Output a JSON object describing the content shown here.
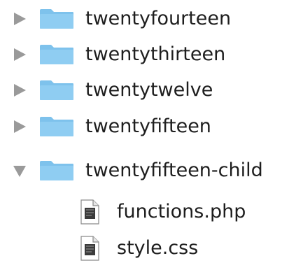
{
  "tree": {
    "items": [
      {
        "name": "twentyfourteen",
        "kind": "folder",
        "expanded": false
      },
      {
        "name": "twentythirteen",
        "kind": "folder",
        "expanded": false
      },
      {
        "name": "twentytwelve",
        "kind": "folder",
        "expanded": false
      },
      {
        "name": "twentyfifteen",
        "kind": "folder",
        "expanded": false
      },
      {
        "name": "twentyfifteen-child",
        "kind": "folder",
        "expanded": true
      },
      {
        "name": "functions.php",
        "kind": "file"
      },
      {
        "name": "style.css",
        "kind": "file"
      }
    ]
  },
  "icons": {
    "collapsed": "disclosure-triangle-right-icon",
    "expanded": "disclosure-triangle-down-icon",
    "folder": "folder-icon",
    "file": "document-icon"
  },
  "colors": {
    "folder": "#8fcdf2",
    "folder_tab": "#7ec2ec",
    "disclosure": "#9a9a9a",
    "text": "#1e1e1e",
    "file_dark": "#3b3b3b"
  }
}
